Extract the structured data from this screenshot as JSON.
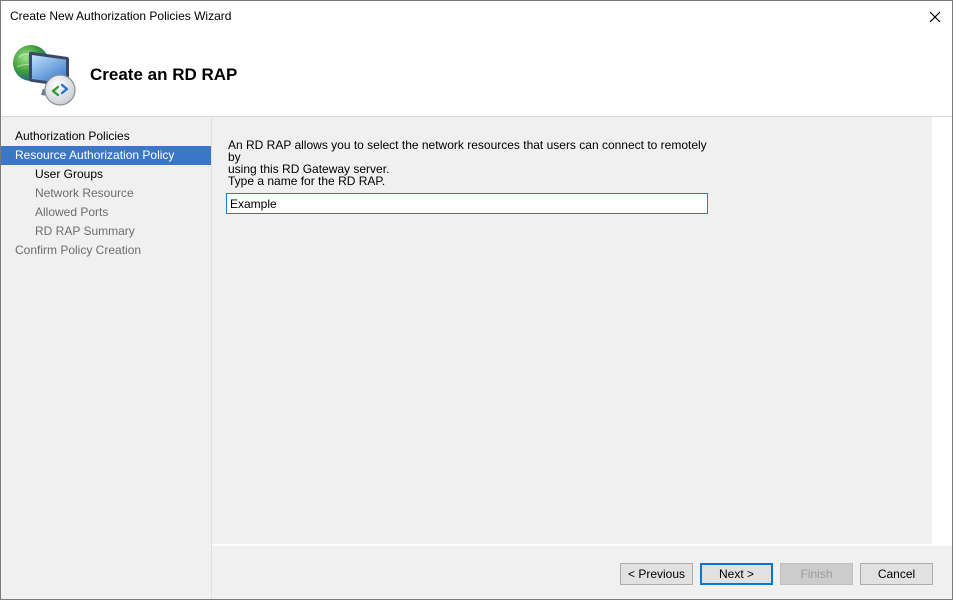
{
  "window": {
    "title": "Create New Authorization Policies Wizard"
  },
  "header": {
    "title": "Create an RD RAP",
    "icon": "rd-gateway-monitor-icon"
  },
  "nav": {
    "items": [
      {
        "label": "Authorization Policies",
        "level": 1,
        "state": "normal"
      },
      {
        "label": "Resource Authorization Policy",
        "level": 1,
        "state": "selected"
      },
      {
        "label": "User Groups",
        "level": 2,
        "state": "normal"
      },
      {
        "label": "Network Resource",
        "level": 2,
        "state": "disabled"
      },
      {
        "label": "Allowed Ports",
        "level": 2,
        "state": "disabled"
      },
      {
        "label": "RD RAP Summary",
        "level": 2,
        "state": "disabled"
      },
      {
        "label": "Confirm Policy Creation",
        "level": 1,
        "state": "disabled"
      }
    ]
  },
  "main": {
    "description_line1": "An RD RAP allows you to select the network resources that users can connect to remotely by",
    "description_line2": "using this RD Gateway server.",
    "prompt": "Type a name for the RD RAP.",
    "name_value": "Example"
  },
  "buttons": {
    "previous": "< Previous",
    "next": "Next >",
    "finish": "Finish",
    "cancel": "Cancel"
  },
  "colors": {
    "selection": "#3c76c8",
    "panel": "#f0f0f0",
    "focus_border": "#0078d7"
  }
}
